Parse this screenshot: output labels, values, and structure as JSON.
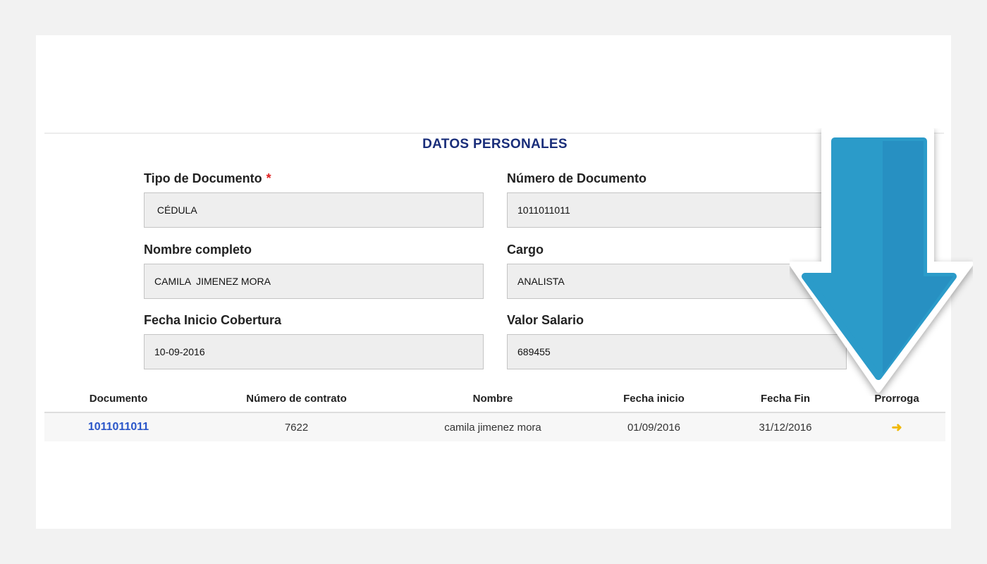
{
  "section_title": "DATOS PERSONALES",
  "fields": {
    "tipo_documento": {
      "label": "Tipo de Documento",
      "required_mark": "*",
      "value": " CÉDULA"
    },
    "numero_documento": {
      "label": "Número de Documento",
      "value": "1011011011"
    },
    "nombre_completo": {
      "label": "Nombre completo",
      "value": "CAMILA  JIMENEZ MORA"
    },
    "cargo": {
      "label": "Cargo",
      "value": "ANALISTA"
    },
    "fecha_inicio_cobertura": {
      "label": "Fecha Inicio Cobertura",
      "value": "10-09-2016"
    },
    "valor_salario": {
      "label": "Valor Salario",
      "value": "689455"
    }
  },
  "table": {
    "headers": [
      "Documento",
      "Número de contrato",
      "Nombre",
      "Fecha inicio",
      "Fecha Fin",
      "Prorroga"
    ],
    "rows": [
      {
        "documento": "1011011011",
        "numero_contrato": "7622",
        "nombre": "camila jimenez mora",
        "fecha_inicio": "01/09/2016",
        "fecha_fin": "31/12/2016",
        "prorroga_icon": "arrow-right-icon"
      }
    ]
  },
  "overlay": {
    "icon": "down-arrow-icon",
    "color": "#2b9bc9",
    "color_dark": "#2790c2"
  },
  "colors": {
    "title": "#1a2e7a",
    "link": "#2a56c9",
    "required": "#e02020",
    "prorroga_icon": "#f1b800"
  }
}
